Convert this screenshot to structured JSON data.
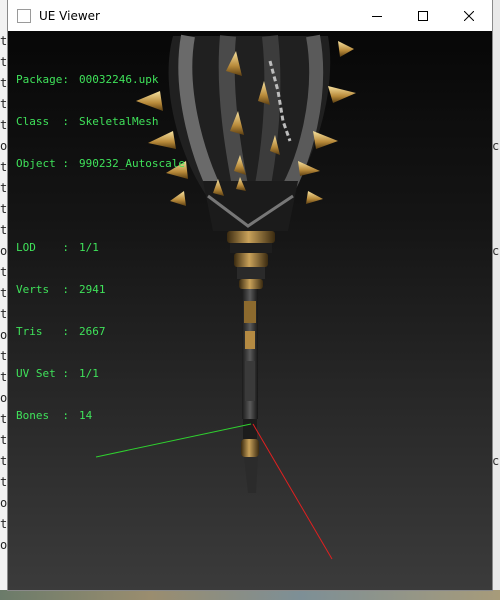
{
  "window": {
    "title": "UE Viewer",
    "controls": {
      "minimize": "minimize",
      "maximize": "maximize",
      "close": "close"
    }
  },
  "info": {
    "package_label": "Package",
    "package": "00032246.upk",
    "class_label": "Class",
    "class": "SkeletalMesh",
    "object_label": "Object",
    "object": "990232_Autoscale",
    "lod_label": "LOD",
    "lod": "1/1",
    "verts_label": "Verts",
    "verts": "2941",
    "tris_label": "Tris",
    "tris": "2667",
    "uvset_label": "UV Set",
    "uvset": "1/1",
    "bones_label": "Bones",
    "bones": "14"
  },
  "colors": {
    "overlay_text": "#3fe25a",
    "axis_x": "#e02020",
    "axis_y": "#2fd02f"
  },
  "background_glyphs_left": [
    "t",
    "t",
    "t",
    "t",
    "t",
    "o",
    "t",
    "t",
    "t",
    "t",
    "o",
    "t",
    "t",
    "t",
    "o",
    "t",
    "t",
    "o",
    "t",
    "t",
    "t",
    "t",
    "o",
    "t",
    "o"
  ],
  "background_glyphs_right": [
    "",
    "",
    "",
    "",
    "",
    "c",
    "",
    "",
    "",
    "",
    "c",
    "",
    "",
    "",
    "",
    "",
    "",
    "",
    "",
    "",
    "c",
    "",
    "",
    "",
    ""
  ]
}
